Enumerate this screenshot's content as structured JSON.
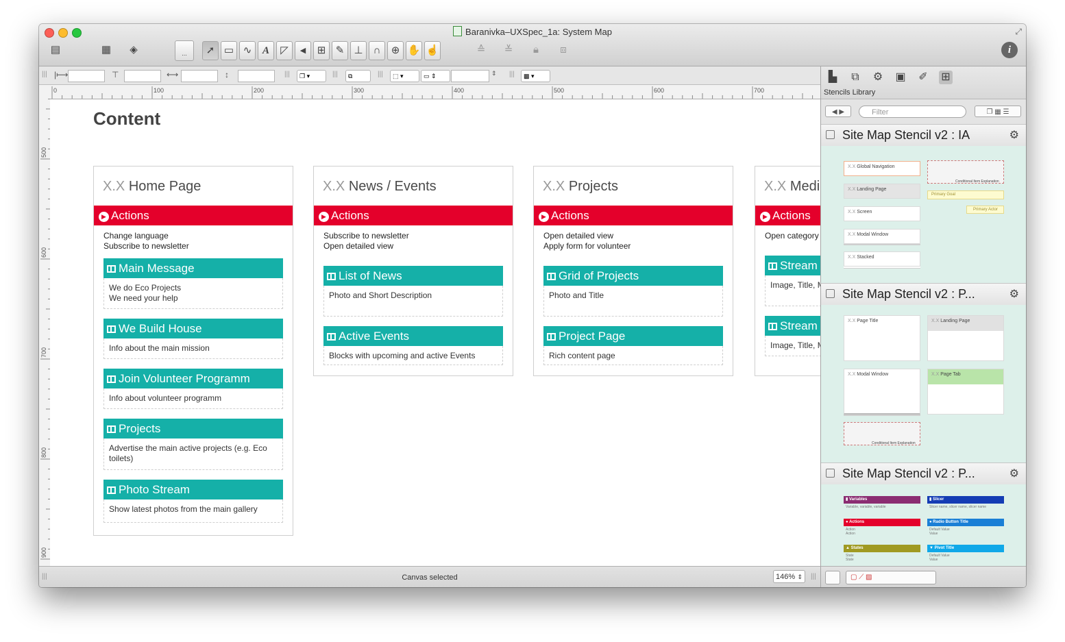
{
  "window": {
    "title": "Baranivka–UXSpec_1a: System Map"
  },
  "toolbar": {
    "sub_icon_label": "..."
  },
  "rulers": {
    "h": [
      "0",
      "100",
      "200",
      "300",
      "400",
      "500",
      "600",
      "700"
    ],
    "v": [
      "500",
      "600",
      "700",
      "800",
      "900"
    ]
  },
  "canvas": {
    "heading": "Content",
    "cards": [
      {
        "prefix": "X.X",
        "name": "Home Page",
        "actions_label": "Actions",
        "action_lines": "Change language\nSubscribe to newsletter",
        "sections": [
          {
            "title": "Main Message",
            "body": "We do Eco Projects\nWe need your help"
          },
          {
            "title": "We Build House",
            "body": "Info about the main mission"
          },
          {
            "title": "Join Volunteer Programm",
            "body": "Info about volunteer programm"
          },
          {
            "title": "Projects",
            "body": "Advertise the main active projects (e.g. Eco toilets)"
          },
          {
            "title": "Photo Stream",
            "body": "Show latest photos from the main gallery"
          }
        ]
      },
      {
        "prefix": "X.X",
        "name": "News / Events",
        "actions_label": "Actions",
        "action_lines": "Subscribe to newsletter\nOpen detailed view",
        "sections": [
          {
            "title": "List of News",
            "body": "Photo and Short Description"
          },
          {
            "title": "Active Events",
            "body": "Blocks with upcoming and active Events"
          }
        ]
      },
      {
        "prefix": "X.X",
        "name": "Projects",
        "actions_label": "Actions",
        "action_lines": "Open detailed view\nApply form for volunteer",
        "sections": [
          {
            "title": "Grid of Projects",
            "body": "Photo and Title"
          },
          {
            "title": "Project Page",
            "body": "Rich content page"
          }
        ]
      },
      {
        "prefix": "X.X",
        "name": "Media",
        "actions_label": "Actions",
        "action_lines": "Open category",
        "sections": [
          {
            "title": "Stream",
            "body": "Image, Title, M"
          },
          {
            "title": "Stream",
            "body": "Image, Title, M"
          }
        ]
      }
    ]
  },
  "status": {
    "text": "Canvas selected",
    "zoom": "146%"
  },
  "sidebar": {
    "tab_label": "Stencils Library",
    "filter_placeholder": "Filter",
    "groups": [
      {
        "title": "Site Map Stencil v2 : IA",
        "items": [
          "Global Navigation",
          "Landing Page",
          "Screen",
          "Modal Window",
          "Stacked",
          "Conditional Item Explanation",
          "Primary Goal",
          "Primary Actor"
        ]
      },
      {
        "title": "Site Map Stencil v2 : P...",
        "items": [
          "Page Title",
          "Landing Page",
          "Modal Window",
          "Page Tab",
          "Conditional Item Explanation"
        ]
      },
      {
        "title": "Site Map Stencil v2 : P...",
        "items": [
          "Variables",
          "Slicer",
          "Actions",
          "Radio Button Title",
          "States",
          "Pivot Title"
        ],
        "item_subtexts": [
          "Variable, variable, variable",
          "Slicer name, slicer name, slicer name",
          "Action\nAction",
          "Default Value\nValue",
          "State\nState",
          "Default Value\nValue"
        ],
        "colors": [
          "#8b2d72",
          "#143cb4",
          "#e4002b",
          "#1a7fd6",
          "#a09a22",
          "#10a8e8"
        ]
      }
    ]
  },
  "colors": {
    "actions_red": "#e4002b",
    "section_teal": "#15b0a8",
    "stencil_bg": "#ddf0ea"
  }
}
